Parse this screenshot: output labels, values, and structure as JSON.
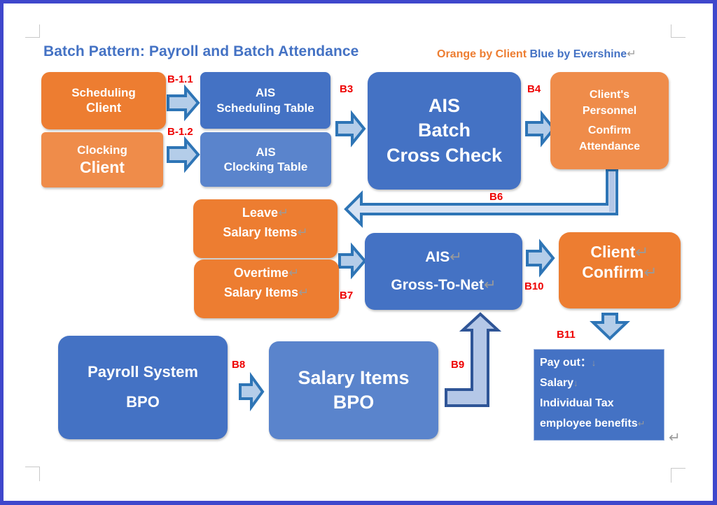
{
  "title": "Batch Pattern: Payroll and Batch Attendance",
  "legend": {
    "orange_label": "Orange by Client",
    "blue_label": "Blue by Evershine",
    "orange_color": "#ed7d31",
    "blue_color": "#4472c4"
  },
  "nodes": {
    "scheduling_client": {
      "line1": "Scheduling",
      "line2": "Client"
    },
    "clocking_client": {
      "line1": "Clocking",
      "line2": "Client"
    },
    "ais_scheduling_table": {
      "line1": "AIS",
      "line2": "Scheduling Table"
    },
    "ais_clocking_table": {
      "line1": "AIS",
      "line2": "Clocking Table"
    },
    "ais_batch_cross_check": {
      "line1": "AIS",
      "line2": "Batch",
      "line3": "Cross Check"
    },
    "clients_personnel": {
      "line1": "Client's",
      "line2": "Personnel",
      "line3": "Confirm",
      "line4": "Attendance"
    },
    "leave_salary_items": {
      "line1": "Leave",
      "line2": "Salary Items"
    },
    "overtime_salary_items": {
      "line1": "Overtime",
      "line2": "Salary Items"
    },
    "ais_gross_to_net": {
      "line1": "AIS",
      "line2": "Gross-To-Net"
    },
    "client_confirm": {
      "line1": "Client",
      "line2": "Confirm"
    },
    "payroll_system_bpo": {
      "line1": "Payroll System",
      "line2": "BPO"
    },
    "salary_items_bpo": {
      "line1": "Salary Items",
      "line2": "BPO"
    },
    "payout": {
      "line1": "Pay out：",
      "line2": "Salary",
      "line3": "Individual Tax",
      "line4": "employee benefits"
    }
  },
  "steps": {
    "b11a": "B-1.1",
    "b12": "B-1.2",
    "b3": "B3",
    "b4": "B4",
    "b6": "B6",
    "b7": "B7",
    "b8": "B8",
    "b9": "B9",
    "b10": "B10",
    "b11": "B11"
  },
  "marks": {
    "return": "↵",
    "down": "↓"
  }
}
